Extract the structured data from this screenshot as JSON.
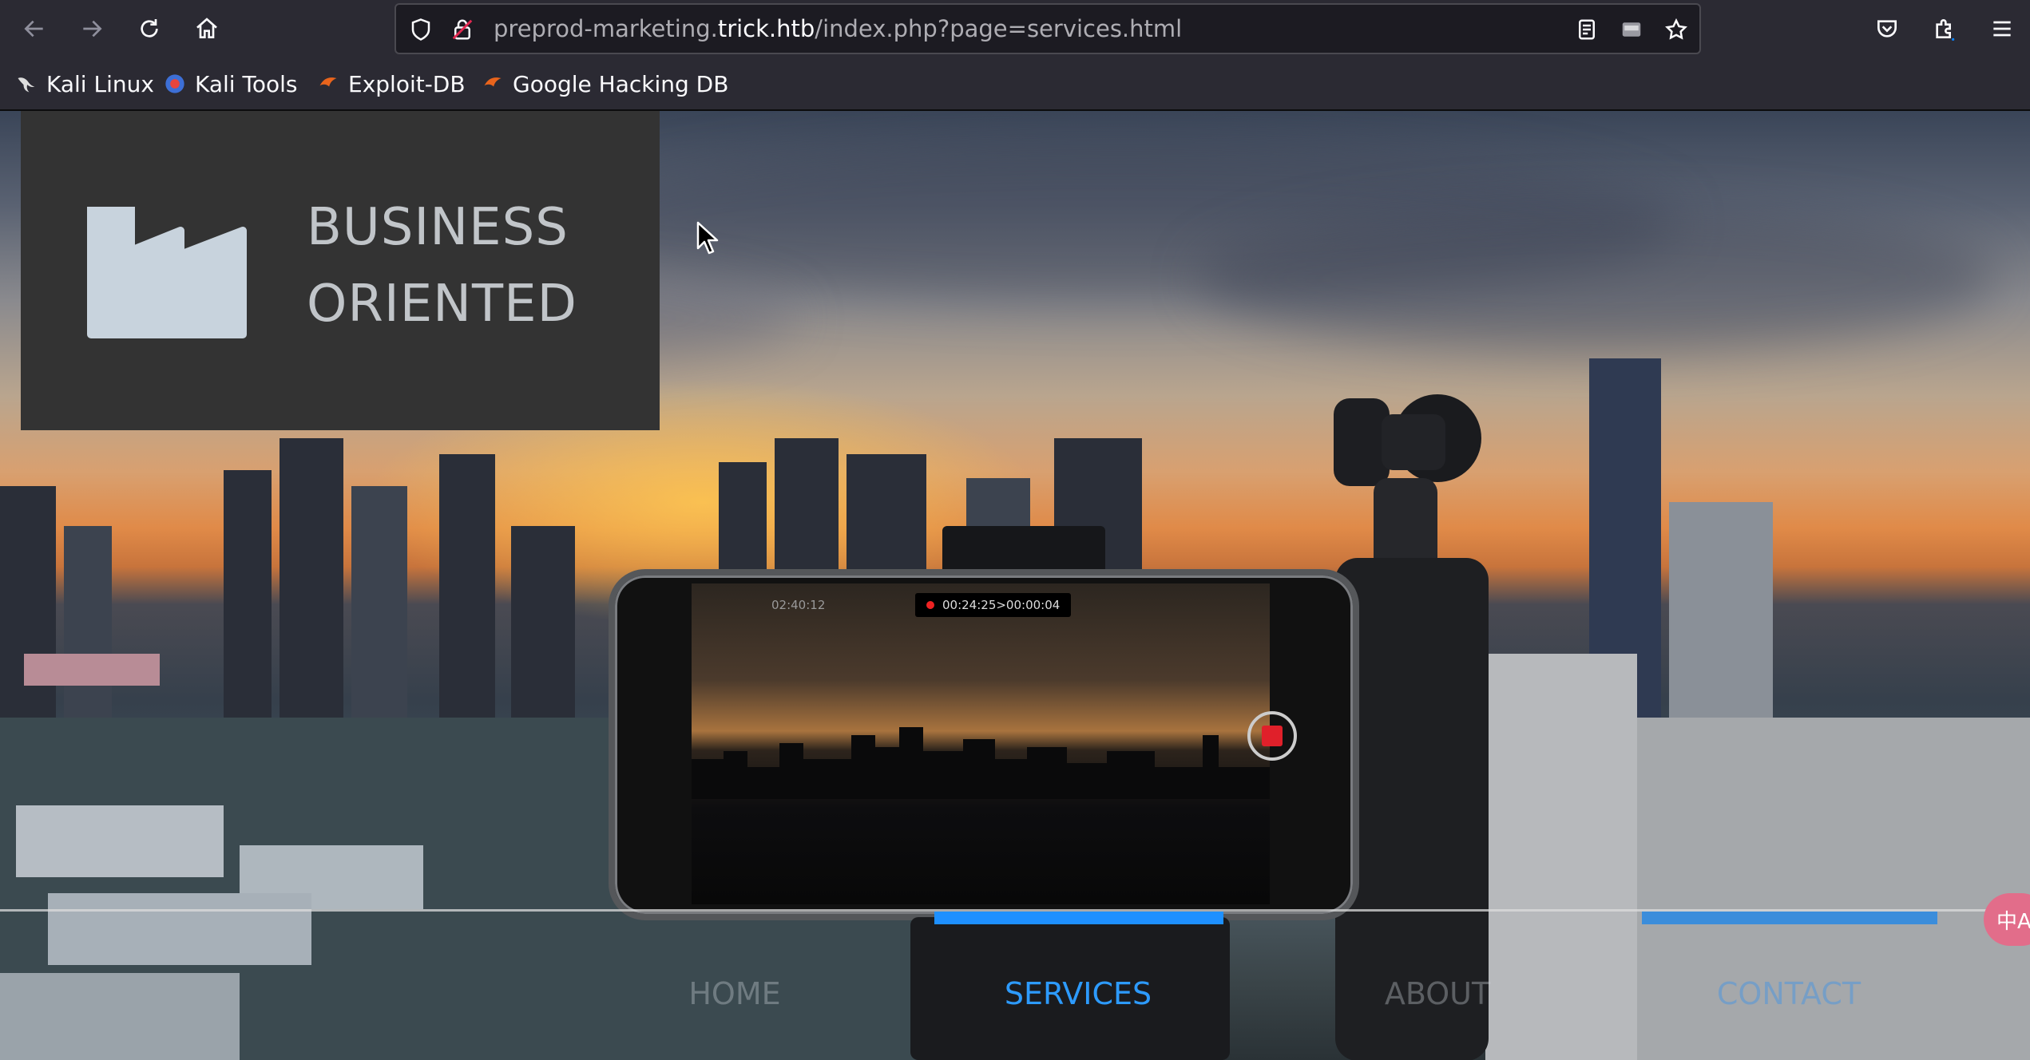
{
  "browser": {
    "nav": {
      "back_icon": "arrow-left-icon",
      "forward_icon": "arrow-right-icon",
      "reload_icon": "reload-icon",
      "home_icon": "home-icon"
    },
    "url": {
      "prefix": "preprod-marketing.",
      "host": "trick.htb",
      "path": "/index.php?page=services.html"
    },
    "bookmarks": [
      {
        "label": "Kali Linux",
        "icon": "kali-dragon-icon"
      },
      {
        "label": "Kali Tools",
        "icon": "kali-tools-icon"
      },
      {
        "label": "Exploit-DB",
        "icon": "exploit-db-icon"
      },
      {
        "label": "Google Hacking DB",
        "icon": "ghdb-icon"
      }
    ]
  },
  "page": {
    "brand": {
      "name": "BUSINESS\nORIENTED",
      "icon": "factory-icon"
    },
    "phone": {
      "clock": "02:40:12",
      "recording": "00:24:25>00:00:04"
    },
    "nav": [
      {
        "label": "HOME",
        "active": false
      },
      {
        "label": "SERVICES",
        "active": true
      },
      {
        "label": "ABOUT",
        "active": false
      },
      {
        "label": "CONTACT",
        "active": false
      }
    ],
    "translate_fab": "中A"
  },
  "colors": {
    "chrome_bg": "#2b2a33",
    "brand_box": "#333333",
    "nav_active": "#2d9bff",
    "nav_indicator": "#1e90ff"
  }
}
